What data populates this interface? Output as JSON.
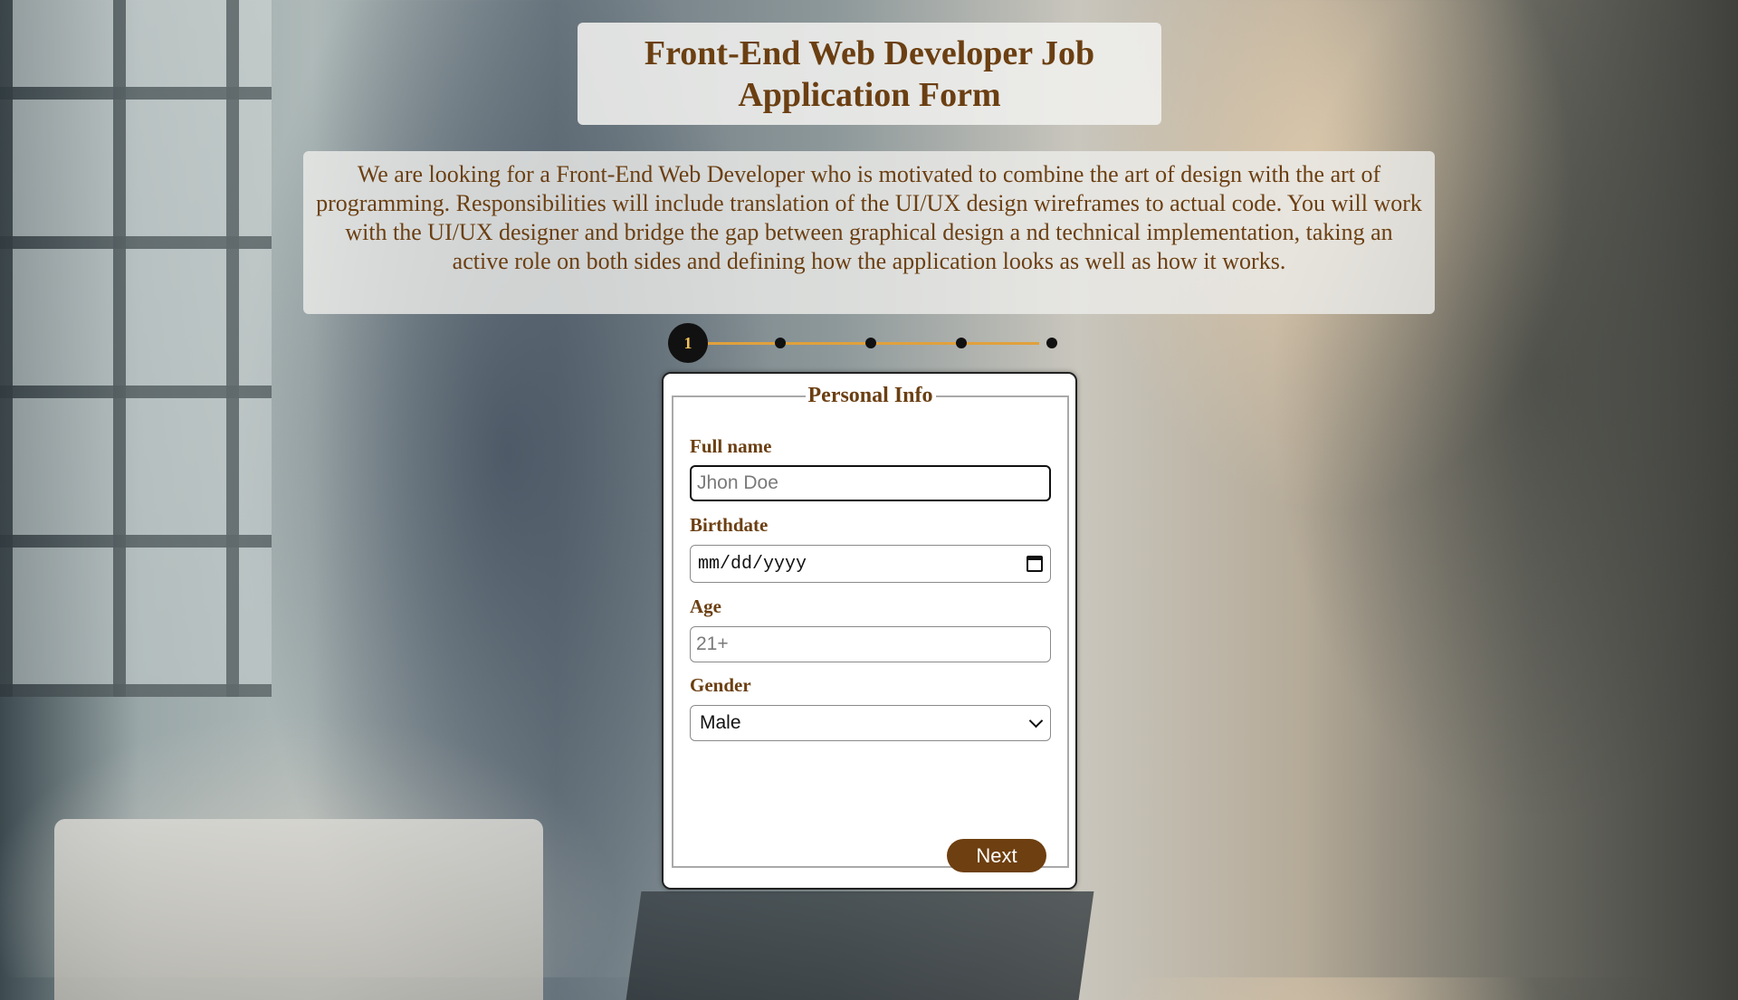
{
  "header": {
    "title": "Front-End Web Developer Job Application Form"
  },
  "description": "We are looking for a Front-End Web Developer who is motivated to combine the art of design with the art of programming. Responsibilities will include translation of the UI/UX design wireframes to actual code. You will work with the UI/UX designer and bridge the gap between graphical design a nd technical implementation, taking an active role on both sides and defining how the application looks as well as how it works.",
  "progress": {
    "current_step": "1",
    "total_steps": 5
  },
  "form": {
    "legend": "Personal Info",
    "full_name": {
      "label": "Full name",
      "placeholder": "Jhon Doe",
      "value": ""
    },
    "birthdate": {
      "label": "Birthdate",
      "placeholder": "mm/dd/yyyy",
      "icon": "calendar-icon"
    },
    "age": {
      "label": "Age",
      "placeholder": "21+",
      "value": ""
    },
    "gender": {
      "label": "Gender",
      "selected": "Male",
      "icon": "chevron-down-icon"
    },
    "next_label": "Next"
  },
  "colors": {
    "accent": "#6b3f12",
    "progress_line": "#e0a13c",
    "step_number": "#f4c15b"
  }
}
